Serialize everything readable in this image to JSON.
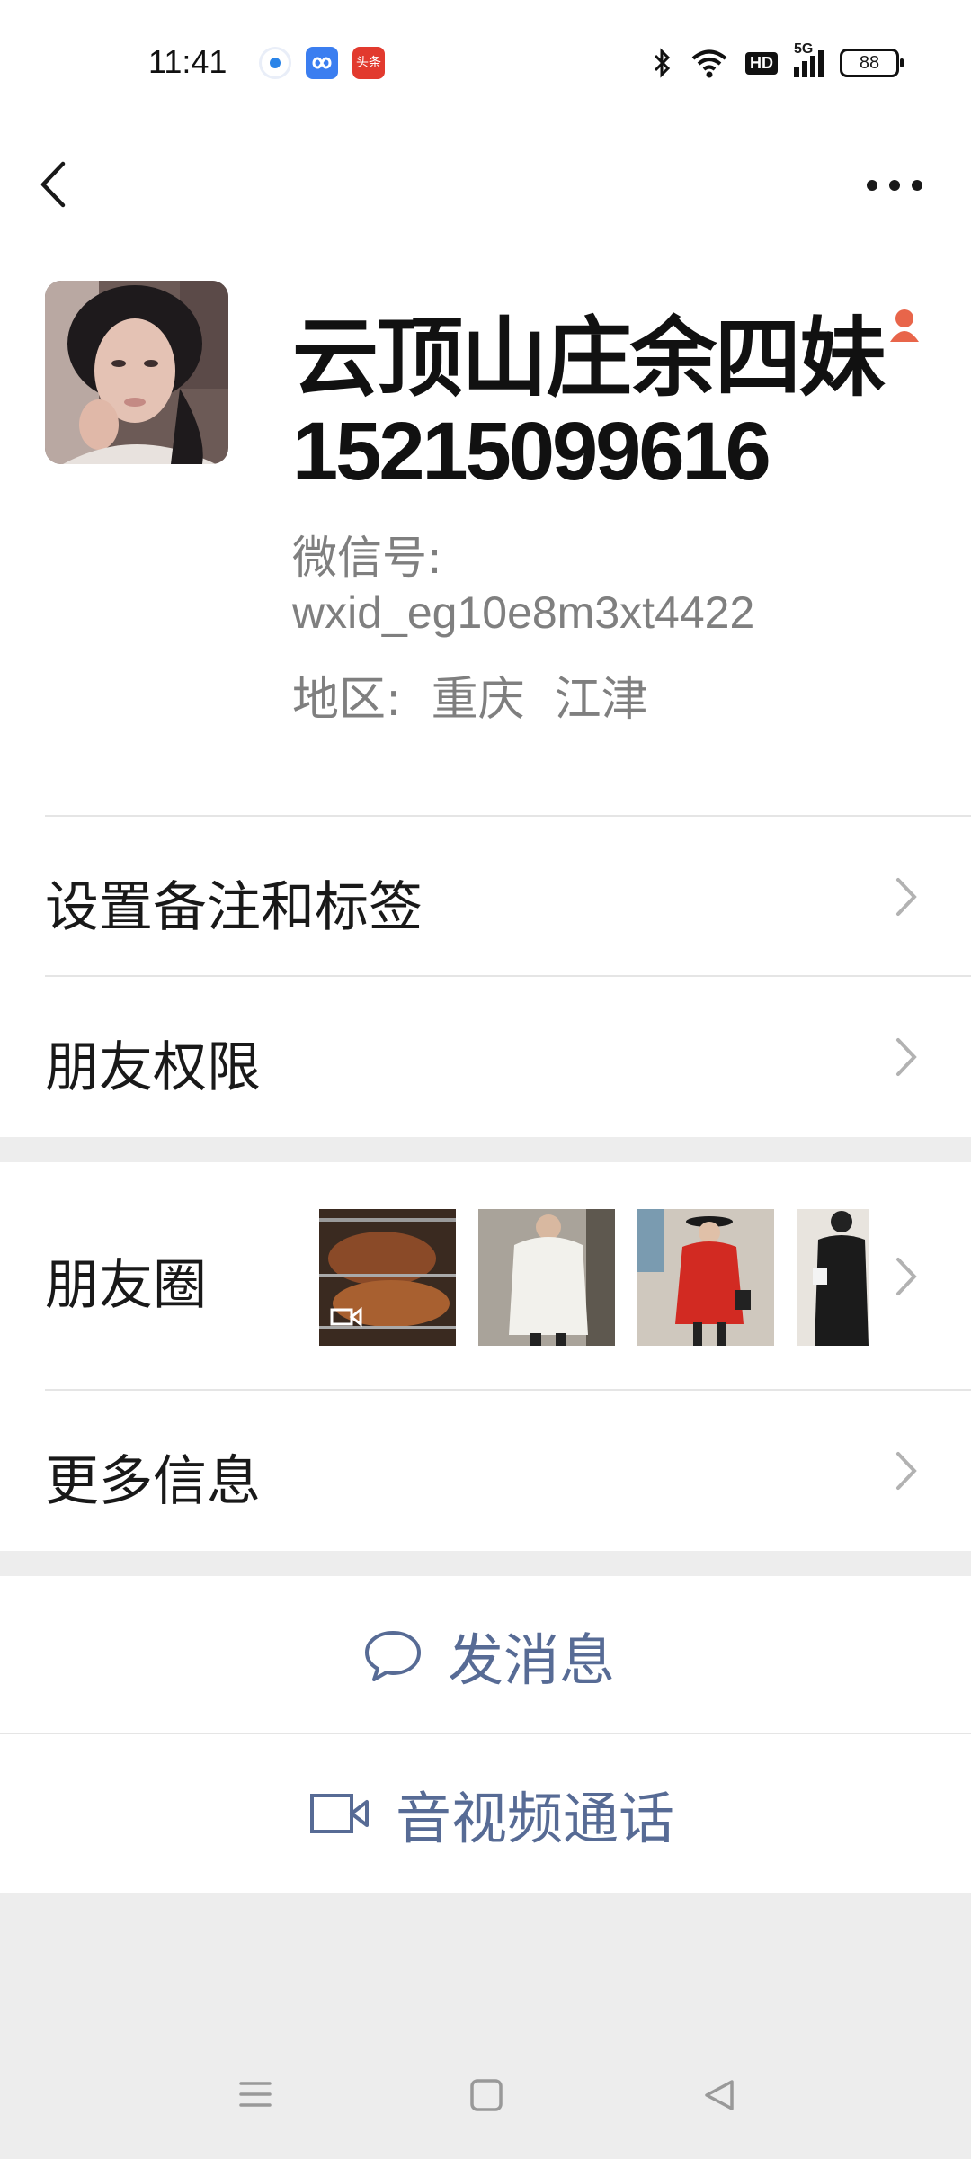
{
  "status_bar": {
    "time": "11:41",
    "notif_3_text": "头条",
    "network": "5G",
    "hd": "HD",
    "battery": "88"
  },
  "profile": {
    "name": "云顶山庄余四妹",
    "phone": "15215099616",
    "wechat_id_label": "微信号:",
    "wechat_id": "wxid_eg10e8m3xt4422",
    "region_label": "地区:",
    "region": "重庆  江津"
  },
  "rows": {
    "remark": "设置备注和标签",
    "permissions": "朋友权限",
    "moments": "朋友圈",
    "more_info": "更多信息"
  },
  "actions": {
    "send_message": "发消息",
    "av_call": "音视频通话"
  },
  "colors": {
    "link_blue": "#576b95",
    "background": "#ededed",
    "gender_icon": "#e8654a"
  },
  "icons": {
    "back": "chevron-left-icon",
    "more": "ellipsis-icon",
    "chat": "chat-bubble-icon",
    "video": "video-camera-icon"
  }
}
